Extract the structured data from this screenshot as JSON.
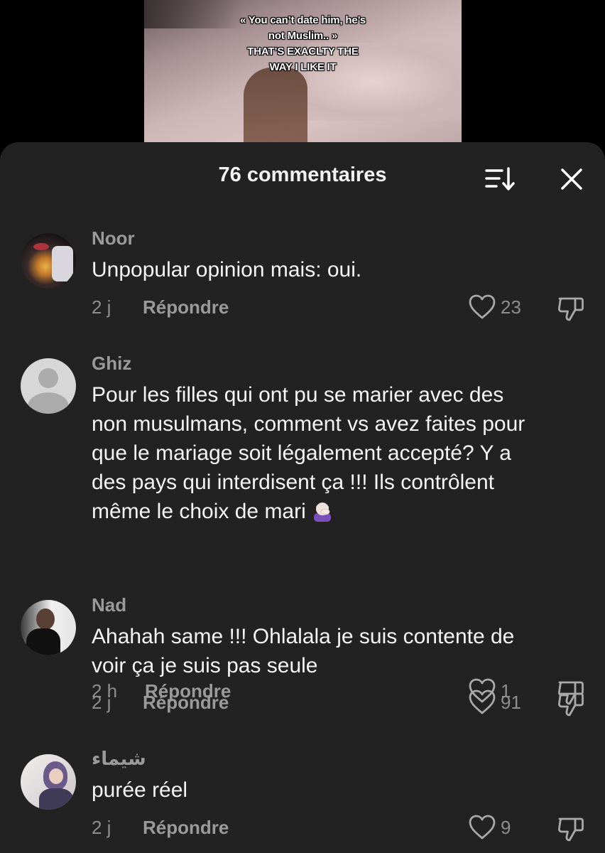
{
  "video": {
    "overlay_lines": [
      "« You can’t date him, he’s",
      "not Muslim.. »",
      "THAT’S EXACLTY THE",
      "WAY I LIKE IT"
    ]
  },
  "comments_sheet": {
    "title": "76 commentaires",
    "sort_icon": "sort-descending-icon",
    "close_icon": "close-icon"
  },
  "comments": [
    {
      "user": "Noor",
      "text": "Unpopular opinion mais: oui.",
      "time": "2 j",
      "reply_label": "Répondre",
      "likes": "23"
    },
    {
      "user": "Ghiz",
      "text_lines": [
        "Pour les filles qui ont pu se marier avec des",
        "non musulmans, comment vs avez faites pour",
        "que le mariage soit légalement accepté? Y a",
        "des pays qui interdisent ça !!! Ils contrôlent",
        "même le choix de mari"
      ],
      "emoji": "facepalm-emoji",
      "time": "2 h",
      "reply_label": "Répondre",
      "likes": "1"
    },
    {
      "user": "Nad",
      "text_lines": [
        "Ahahah same !!! Ohlalala je suis contente de",
        "voir ça je suis pas seule"
      ],
      "time": "2 j",
      "reply_label": "Répondre",
      "likes": "91"
    },
    {
      "user": "شيماء",
      "text": "purée réel",
      "time": "2 j",
      "reply_label": "Répondre",
      "likes": "9"
    }
  ]
}
